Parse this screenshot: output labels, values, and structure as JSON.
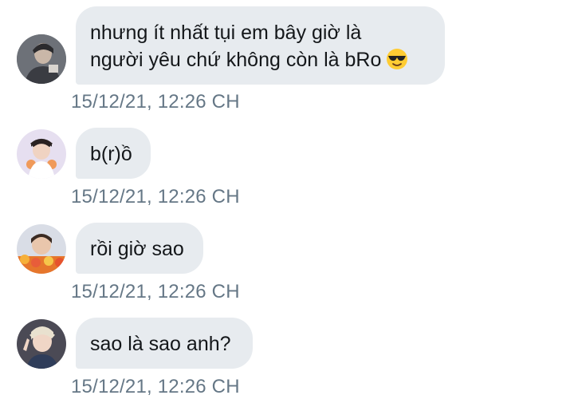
{
  "messages": [
    {
      "sender": "avatar-1",
      "line1": "nhưng ít nhất tụi em bây giờ là",
      "line2": "người yêu chứ không còn là bRo",
      "emoji": "smiling-face-with-sunglasses-icon",
      "timestamp": "15/12/21, 12:26 CH"
    },
    {
      "sender": "avatar-2",
      "text": "b(r)ồ",
      "timestamp": "15/12/21, 12:26 CH"
    },
    {
      "sender": "avatar-3",
      "text": "rồi giờ sao",
      "timestamp": "15/12/21, 12:26 CH"
    },
    {
      "sender": "avatar-4",
      "text": "sao là sao anh?",
      "timestamp": "15/12/21, 12:26 CH"
    }
  ],
  "colors": {
    "bubble": "#e7ebef",
    "text": "#14171a",
    "timestamp": "#657786"
  }
}
